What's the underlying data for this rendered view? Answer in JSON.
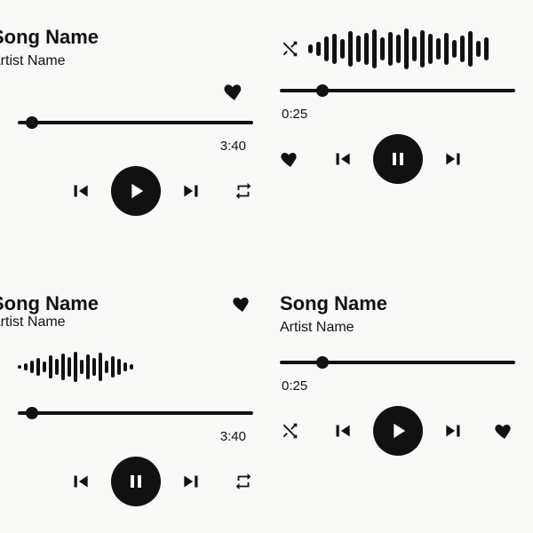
{
  "players": {
    "tl": {
      "song": "Song Name",
      "artist": "Artist Name",
      "time": "3:40",
      "progress_pct": 6
    },
    "tr": {
      "time": "0:25",
      "progress_pct": 18,
      "wave_heights": [
        10,
        16,
        28,
        34,
        22,
        40,
        30,
        36,
        44,
        26,
        38,
        32,
        46,
        28,
        42,
        34,
        24,
        36,
        20,
        30,
        40,
        18,
        26
      ]
    },
    "bl": {
      "song": "Song Name",
      "artist": "Artist Name",
      "time": "3:40",
      "progress_pct": 6,
      "wave_heights": [
        4,
        8,
        14,
        20,
        12,
        26,
        18,
        30,
        22,
        34,
        16,
        28,
        20,
        32,
        14,
        24,
        18,
        10,
        6
      ]
    },
    "br": {
      "song": "Song Name",
      "artist": "Artist Name",
      "time": "0:25",
      "progress_pct": 18
    }
  }
}
